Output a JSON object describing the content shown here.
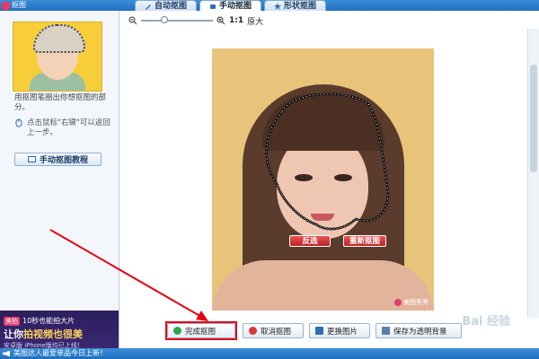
{
  "app": {
    "title": "抠图"
  },
  "tabs": [
    {
      "label": "自动抠图",
      "active": false
    },
    {
      "label": "手动抠图",
      "active": true
    },
    {
      "label": "形状抠图",
      "active": false
    }
  ],
  "left": {
    "instruction": "用抠图笔圈出你想抠图的部分。",
    "tip": "点击鼠标\"右键\"可以返回上一步。",
    "tutorial_button": "手动抠图教程",
    "ad": {
      "badge": "美拍",
      "line1": "10秒也能拍大片",
      "line2_prefix": "让你",
      "line2_highlight": "拍视频也很美",
      "line3": "安卓版  iPhone版均已上线！"
    }
  },
  "zoom": {
    "ratio": "1:1",
    "label": "原大",
    "level": 0.33
  },
  "photo": {
    "btn_invert": "反选",
    "btn_redraw": "重新抠图",
    "watermark": "美图秀秀"
  },
  "actions": {
    "done": "完成抠图",
    "cancel": "取消抠图",
    "replace": "更换图片",
    "save": "保存为透明背景"
  },
  "watermark_site": "Bai 经验",
  "status": {
    "text": "美图达人最爱单品今日上新！"
  },
  "colors": {
    "accent": "#1f6fbf",
    "highlight": "#e60012",
    "ad_bg": "#2b1f5d"
  }
}
